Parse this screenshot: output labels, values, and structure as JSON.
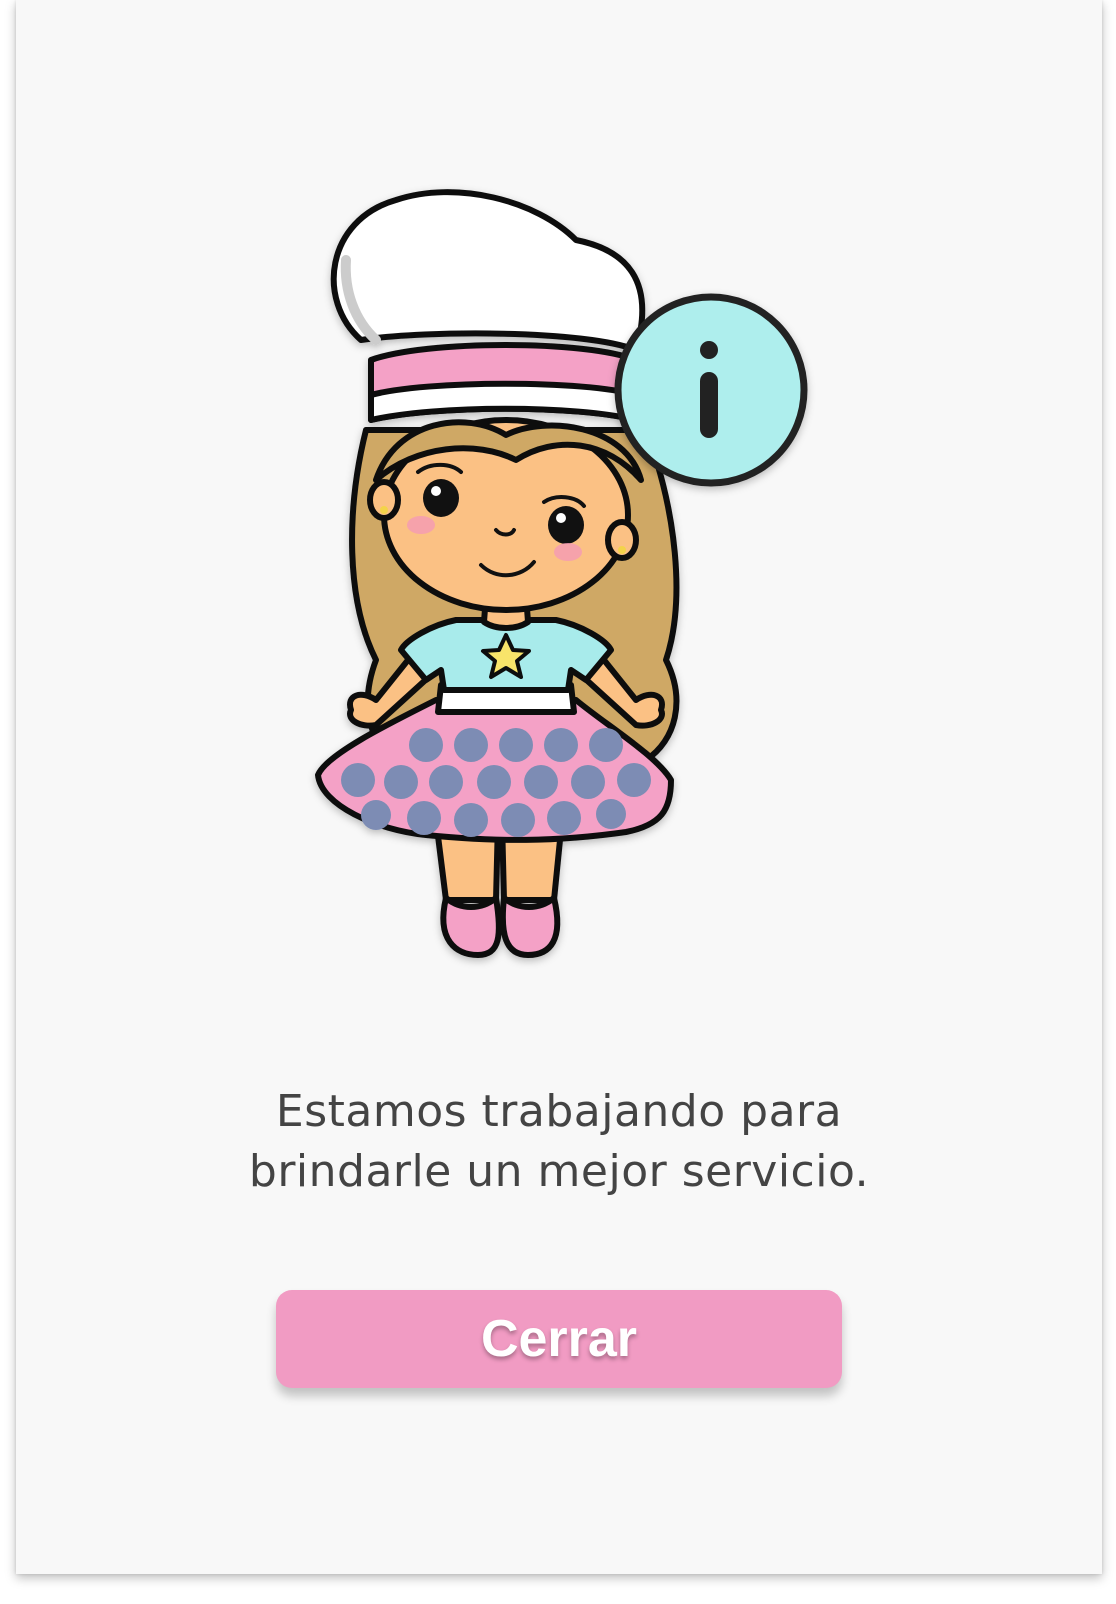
{
  "dialog": {
    "illustration_icon": "chef-girl-info-illustration",
    "badge_icon": "info-icon",
    "message_lines": [
      "Estamos trabajando para",
      "brindarle un mejor servicio."
    ],
    "close_label": "Cerrar"
  },
  "colors": {
    "background": "#f8f8f8",
    "button": "#f19bc3",
    "button_text": "#ffffff",
    "message_text": "#444444",
    "info_badge": "#aeeeed",
    "skirt": "#f4a1c6",
    "polka_dots": "#7d8cb4",
    "shirt": "#a8ebeb",
    "hair": "#cfa865",
    "skin": "#fbc184"
  }
}
